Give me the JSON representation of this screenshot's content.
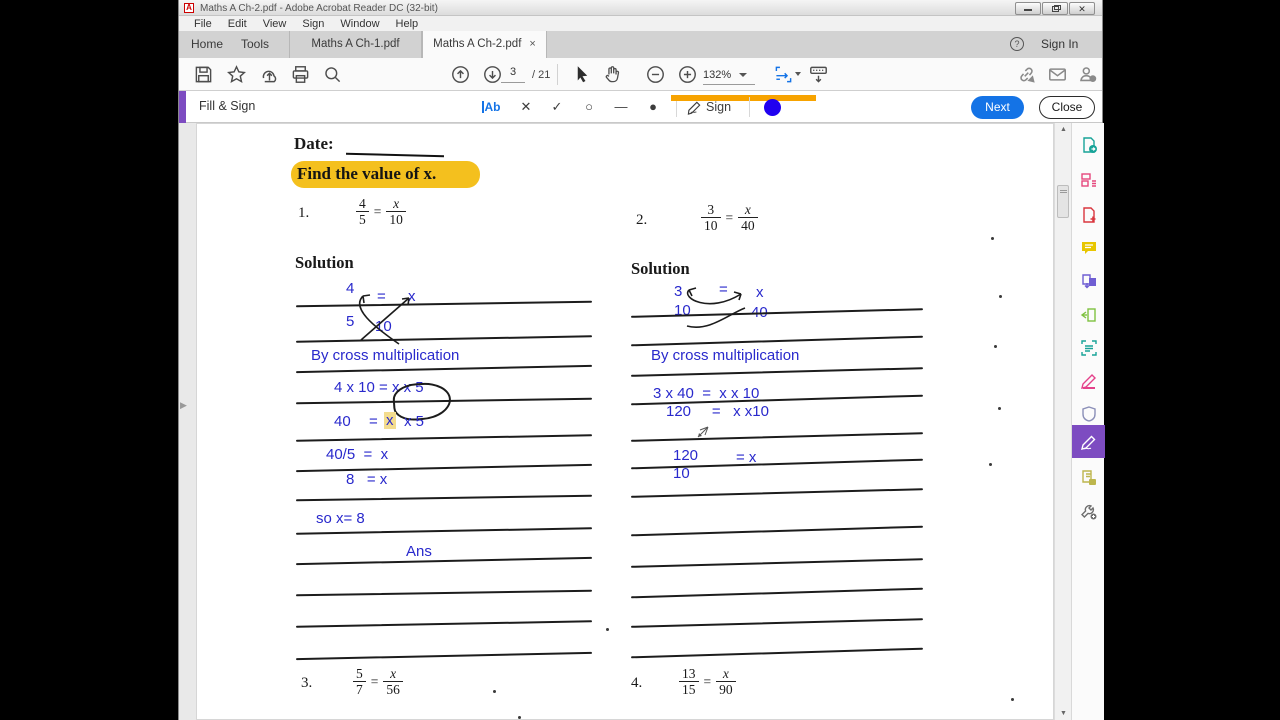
{
  "window": {
    "title": "Maths A Ch-2.pdf - Adobe Acrobat Reader DC (32-bit)",
    "adobe_glyph": "A"
  },
  "menu": {
    "items": [
      "File",
      "Edit",
      "View",
      "Sign",
      "Window",
      "Help"
    ]
  },
  "tabs": {
    "home": "Home",
    "tools": "Tools",
    "doc1": "Maths A Ch-1.pdf",
    "doc2": "Maths A Ch-2.pdf",
    "close_glyph": "×",
    "help_glyph": "?",
    "sign_in": "Sign In"
  },
  "toolbar": {
    "page_current": "3",
    "page_total": "/ 21",
    "zoom_level": "132%"
  },
  "fill_sign": {
    "label": "Fill & Sign",
    "text_tool_label": "Ab",
    "tool_glyphs": {
      "cross": "✕",
      "check": "✓",
      "circle": "○",
      "line": "—",
      "dot": "●"
    },
    "sign_label": "Sign",
    "next_label": "Next",
    "close_label": "Close",
    "accent_color": "#7d4cc1",
    "swatch_color": "#2001f0",
    "annotation_color": "#f7a300",
    "next_color": "#1473e6"
  },
  "sidebar": {
    "tools": [
      "export-pdf",
      "organize-pages",
      "create-pdf",
      "comment",
      "combine-files",
      "edit-pdf",
      "scan-ocr",
      "highlight",
      "protect",
      "fill-and-sign",
      "request-signatures",
      "more-tools"
    ],
    "active": "fill-and-sign"
  },
  "doc": {
    "date_label": "Date:",
    "heading": "Find the value of x.",
    "solution_label": "Solution",
    "problems": [
      {
        "number": "1.",
        "n1": "4",
        "d1": "5",
        "eq": "=",
        "n2": "x",
        "d2": "10"
      },
      {
        "number": "2.",
        "n1": "3",
        "d1": "10",
        "eq": "=",
        "n2": "x",
        "d2": "40"
      },
      {
        "number": "3.",
        "n1": "5",
        "d1": "7",
        "eq": "=",
        "n2": "x",
        "d2": "56"
      },
      {
        "number": "4.",
        "n1": "13",
        "d1": "15",
        "eq": "=",
        "n2": "x",
        "d2": "90"
      }
    ],
    "left": {
      "cross_tl": "4",
      "cross_eq": "=",
      "cross_tr": "x",
      "cross_bl": "5",
      "cross_br": "10",
      "step1": "By cross multiplication",
      "step2": "4 x 10 = x x 5",
      "step3a": "40",
      "step3b": "=",
      "step3c": "x",
      "step3d": "x 5",
      "step4": "40/5  =  x",
      "step5": "8   = x",
      "step6": "so x= 8",
      "ans": "Ans"
    },
    "right": {
      "cross_tl": "3",
      "cross_eq": "=",
      "cross_tr": "x",
      "cross_bl": "10",
      "cross_br": "40",
      "step1": "By cross multiplication",
      "step2": "3 x 40  =  x x 10",
      "step3": "120     =   x x10",
      "frac_num": "120",
      "frac_den": "10",
      "eq_x": "= x"
    }
  }
}
